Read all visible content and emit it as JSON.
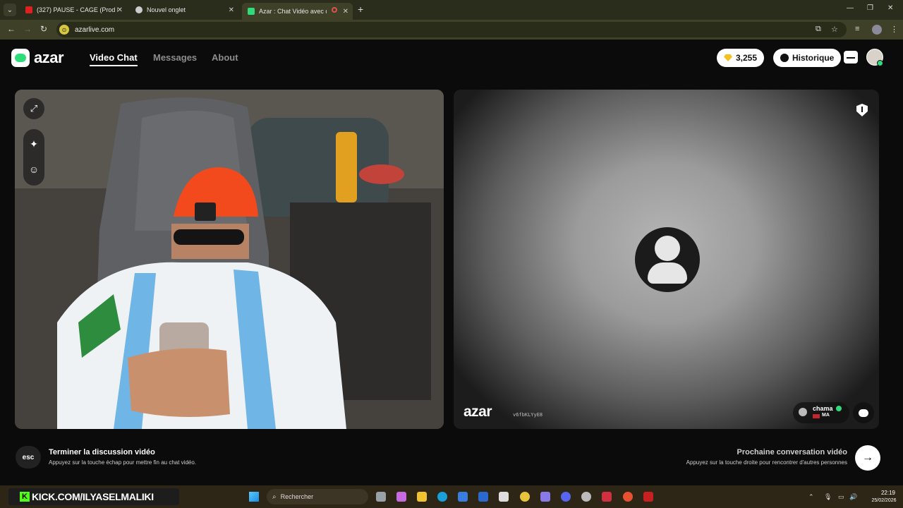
{
  "browser": {
    "tabs": [
      {
        "title": "(327) PAUSE - CAGE (Prod by D",
        "favicon_color": "#e02020"
      },
      {
        "title": "Nouvel onglet",
        "favicon_color": "#cccccc"
      },
      {
        "title": "Azar : Chat Vidéo avec de",
        "favicon_color": "#2fdc7b"
      }
    ],
    "new_tab_glyph": "+",
    "url": "azarlive.com"
  },
  "header": {
    "logo_text": "azar",
    "nav": [
      {
        "label": "Video Chat",
        "active": true
      },
      {
        "label": "Messages",
        "active": false
      },
      {
        "label": "About",
        "active": false
      }
    ],
    "gems_count": "3,255",
    "history_label": "Historique"
  },
  "peer": {
    "watermark_logo": "azar",
    "watermark_id": "v6fbKLYyE8",
    "name": "chama",
    "country": "MA"
  },
  "footer": {
    "esc_key": "esc",
    "end_title": "Terminer la discussion vidéo",
    "end_subtitle": "Appuyez sur la touche échap pour mettre fin au chat vidéo.",
    "next_title": "Prochaine conversation vidéo",
    "next_subtitle": "Appuyez sur la touche droite pour rencontrer d'autres personnes"
  },
  "taskbar": {
    "kick_banner": "KICK.COM/ILYASELMALIKI",
    "search_placeholder": "Rechercher",
    "time": "22:19",
    "date": "25/02/2026"
  },
  "colors": {
    "brand_green": "#2fdc7b",
    "tab_strip": "#2b2d1c",
    "toolbar": "#3e4127"
  }
}
